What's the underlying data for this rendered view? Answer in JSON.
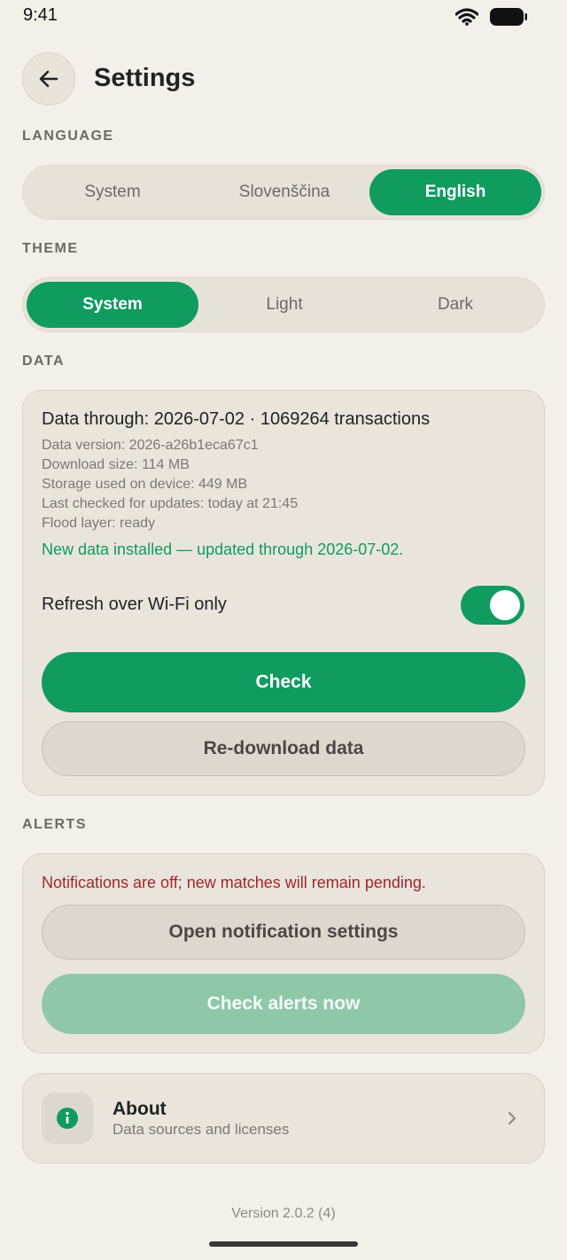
{
  "status_bar": {
    "time": "9:41"
  },
  "header": {
    "title": "Settings"
  },
  "language": {
    "label": "LANGUAGE",
    "options": [
      "System",
      "Slovenščina",
      "English"
    ],
    "selected": "English"
  },
  "theme": {
    "label": "THEME",
    "options": [
      "System",
      "Light",
      "Dark"
    ],
    "selected": "System"
  },
  "data": {
    "label": "DATA",
    "headline": "Data through: 2026-07-02 · 1069264 transactions",
    "details": [
      "Data version: 2026-a26b1eca67c1",
      "Download size: 114 MB",
      "Storage used on device: 449 MB",
      "Last checked for updates: today at 21:45",
      "Flood layer: ready"
    ],
    "success_message": "New data installed — updated through 2026-07-02.",
    "wifi_only_label": "Refresh over Wi-Fi only",
    "wifi_only_enabled": true,
    "check_button": "Check",
    "redownload_button": "Re-download data"
  },
  "alerts": {
    "label": "ALERTS",
    "warning": "Notifications are off; new matches will remain pending.",
    "open_settings_button": "Open notification settings",
    "check_now_button": "Check alerts now"
  },
  "about": {
    "title": "About",
    "subtitle": "Data sources and licenses"
  },
  "footer": {
    "version": "Version 2.0.2 (4)"
  },
  "colors": {
    "accent": "#109b5f",
    "background": "#f3f0e9",
    "warning": "#a3262a"
  }
}
